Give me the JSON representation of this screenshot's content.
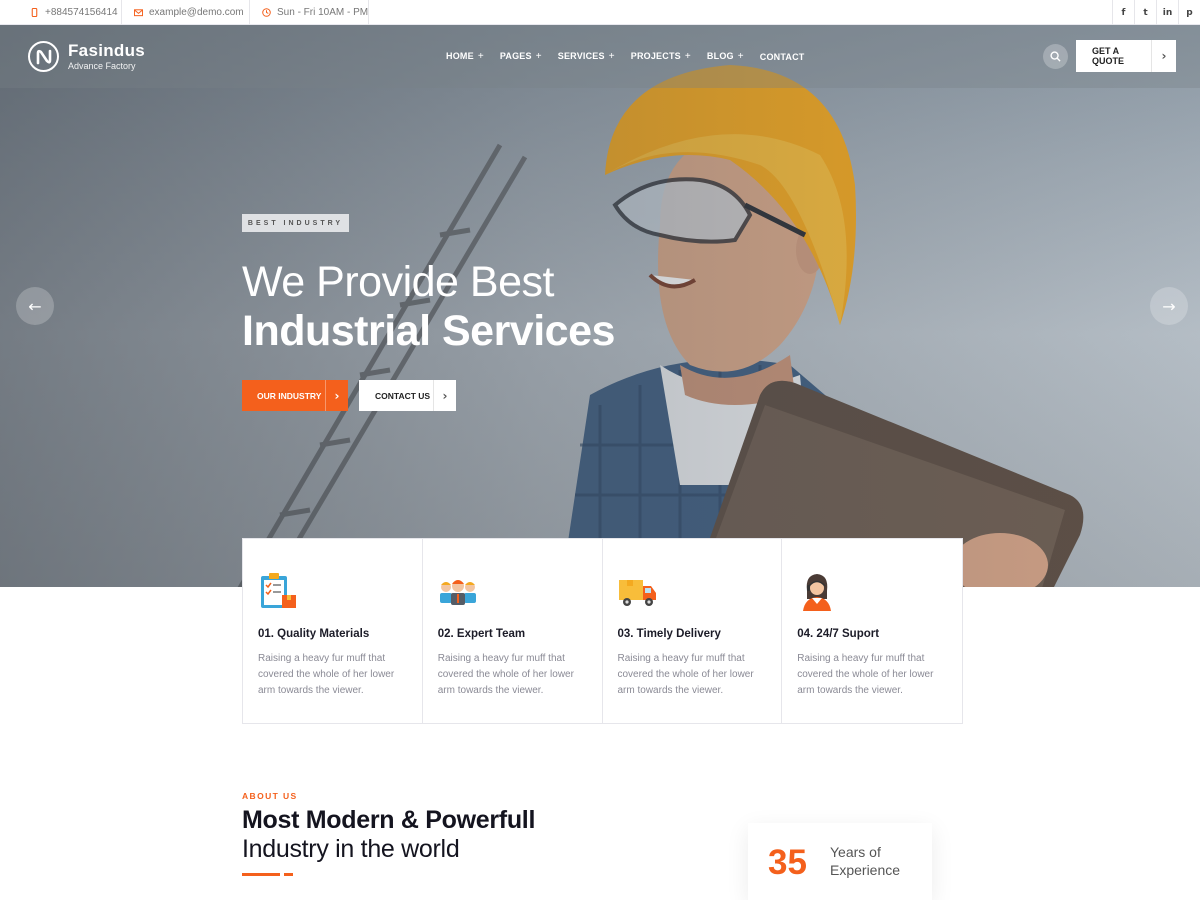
{
  "topbar": {
    "phone": "+884574156414",
    "email": "example@demo.com",
    "hours": "Sun - Fri 10AM - PM",
    "social": [
      {
        "icon": "facebook-icon",
        "glyph": "f"
      },
      {
        "icon": "twitter-icon",
        "glyph": "t"
      },
      {
        "icon": "linkedin-icon",
        "glyph": "in"
      },
      {
        "icon": "pinterest-icon",
        "glyph": "p"
      }
    ]
  },
  "header": {
    "brand": "Fasindus",
    "tagline": "Advance Factory",
    "nav": [
      {
        "label": "HOME",
        "has_sub": true
      },
      {
        "label": "PAGES",
        "has_sub": true
      },
      {
        "label": "SERVICES",
        "has_sub": true
      },
      {
        "label": "PROJECTS",
        "has_sub": true
      },
      {
        "label": "BLOG",
        "has_sub": true
      },
      {
        "label": "CONTACT",
        "has_sub": false
      }
    ],
    "quote_button": "GET A QUOTE"
  },
  "hero": {
    "badge": "BEST INDUSTRY",
    "title_line1": "We Provide Best",
    "title_line2": "Industrial Services",
    "primary_button": "OUR INDUSTRY",
    "secondary_button": "CONTACT US"
  },
  "features": [
    {
      "icon": "clipboard-checklist-icon",
      "title": "01. Quality Materials",
      "desc": "Raising a heavy fur muff that covered the whole of her lower arm towards the viewer."
    },
    {
      "icon": "team-icon",
      "title": "02. Expert Team",
      "desc": "Raising a heavy fur muff that covered the whole of her lower arm towards the viewer."
    },
    {
      "icon": "delivery-truck-icon",
      "title": "03. Timely Delivery",
      "desc": "Raising a heavy fur muff that covered the whole of her lower arm towards the viewer."
    },
    {
      "icon": "support-agent-icon",
      "title": "04. 24/7 Suport",
      "desc": "Raising a heavy fur muff that covered the whole of her lower arm towards the viewer."
    }
  ],
  "about": {
    "label": "ABOUT US",
    "title_bold": "Most Modern & Powerfull",
    "title_light": "Industry in the world",
    "experience_number": "35",
    "experience_text": "Years of Experience"
  },
  "colors": {
    "accent": "#f4601c",
    "dark": "#14141f",
    "muted": "#8a8a95"
  }
}
